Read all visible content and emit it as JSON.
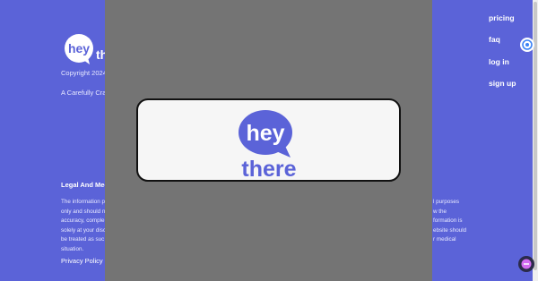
{
  "footer": {
    "logo_alt": "hey there",
    "copyright": "Copyright 2024",
    "tagline": "A Carefully Craft",
    "legal_title": "Legal And Med",
    "legal_left": [
      "The information p",
      "only and should n",
      "accuracy, comple",
      "solely at your disc",
      "be treated as suc",
      "situation."
    ],
    "legal_right": [
      "l purposes",
      "w the",
      "formation is",
      "ebsite should",
      "r medical"
    ],
    "privacy_label": "Privacy Policy"
  },
  "nav": {
    "items": [
      "pricing",
      "faq",
      "log in",
      "sign up"
    ]
  },
  "modal": {
    "logo_word_1": "hey",
    "logo_word_2": "there"
  },
  "icons": {
    "side_widget": "translate-icon",
    "chat_widget": "chat-icon"
  },
  "colors": {
    "brand_purple": "#5b63d8",
    "overlay_gray": "#747474",
    "modal_bg": "#f6f6f6"
  }
}
